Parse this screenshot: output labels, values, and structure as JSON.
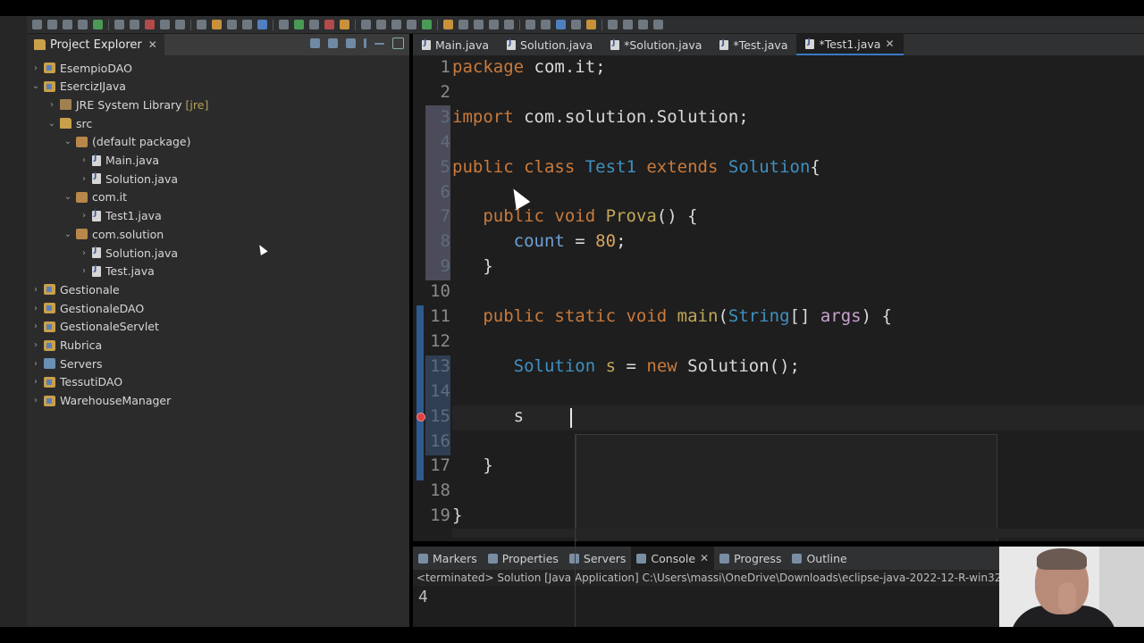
{
  "project_explorer": {
    "title": "Project Explorer",
    "tree": [
      {
        "label": "EsempioDAO",
        "level": 0,
        "expanded": false,
        "icon": "project-icon"
      },
      {
        "label": "EsercizIJava",
        "level": 0,
        "expanded": true,
        "icon": "project-icon"
      },
      {
        "label": "JRE System Library",
        "decoration": "[jre]",
        "level": 1,
        "expanded": false,
        "icon": "library-icon"
      },
      {
        "label": "src",
        "level": 1,
        "expanded": true,
        "icon": "folder-icon"
      },
      {
        "label": "(default package)",
        "level": 2,
        "expanded": true,
        "icon": "package-icon"
      },
      {
        "label": "Main.java",
        "level": 3,
        "expanded": false,
        "icon": "java-file-icon"
      },
      {
        "label": "Solution.java",
        "level": 3,
        "expanded": false,
        "icon": "java-file-icon"
      },
      {
        "label": "com.it",
        "level": 2,
        "expanded": true,
        "icon": "package-icon"
      },
      {
        "label": "Test1.java",
        "level": 3,
        "expanded": false,
        "icon": "java-file-icon"
      },
      {
        "label": "com.solution",
        "level": 2,
        "expanded": true,
        "icon": "package-icon"
      },
      {
        "label": "Solution.java",
        "level": 3,
        "expanded": false,
        "icon": "java-file-icon"
      },
      {
        "label": "Test.java",
        "level": 3,
        "expanded": false,
        "icon": "java-file-icon"
      },
      {
        "label": "Gestionale",
        "level": 0,
        "expanded": false,
        "icon": "project-icon"
      },
      {
        "label": "GestionaleDAO",
        "level": 0,
        "expanded": false,
        "icon": "project-icon"
      },
      {
        "label": "GestionaleServlet",
        "level": 0,
        "expanded": false,
        "icon": "project-icon"
      },
      {
        "label": "Rubrica",
        "level": 0,
        "expanded": false,
        "icon": "project-icon"
      },
      {
        "label": "Servers",
        "level": 0,
        "expanded": false,
        "icon": "servers-folder-icon"
      },
      {
        "label": "TessutiDAO",
        "level": 0,
        "expanded": false,
        "icon": "project-icon"
      },
      {
        "label": "WarehouseManager",
        "level": 0,
        "expanded": false,
        "icon": "project-icon"
      }
    ]
  },
  "editor": {
    "tabs": [
      {
        "label": "Main.java",
        "active": false
      },
      {
        "label": "Solution.java",
        "active": false
      },
      {
        "label": "*Solution.java",
        "active": false
      },
      {
        "label": "*Test.java",
        "active": false
      },
      {
        "label": "*Test1.java",
        "active": true
      }
    ],
    "lines": [
      {
        "n": "1",
        "tokens": [
          {
            "t": "package",
            "c": "kw"
          },
          {
            "t": " com.it;",
            "c": ""
          }
        ]
      },
      {
        "n": "2",
        "tokens": []
      },
      {
        "n": "3",
        "tokens": [
          {
            "t": "import",
            "c": "kw"
          },
          {
            "t": " com.solution.Solution;",
            "c": ""
          }
        ]
      },
      {
        "n": "4",
        "tokens": []
      },
      {
        "n": "5",
        "tokens": [
          {
            "t": "public class ",
            "c": "kw"
          },
          {
            "t": "Test1",
            "c": "ty"
          },
          {
            "t": " extends ",
            "c": "kw"
          },
          {
            "t": "Solution",
            "c": "ty"
          },
          {
            "t": "{",
            "c": ""
          }
        ]
      },
      {
        "n": "6",
        "tokens": []
      },
      {
        "n": "7",
        "tokens": [
          {
            "t": "   public void ",
            "c": "kw"
          },
          {
            "t": "Prova",
            "c": "mt"
          },
          {
            "t": "() {",
            "c": ""
          }
        ]
      },
      {
        "n": "8",
        "tokens": [
          {
            "t": "      ",
            "c": ""
          },
          {
            "t": "count",
            "c": "fd"
          },
          {
            "t": " = ",
            "c": ""
          },
          {
            "t": "80",
            "c": "num"
          },
          {
            "t": ";",
            "c": ""
          }
        ]
      },
      {
        "n": "9",
        "tokens": [
          {
            "t": "   }",
            "c": ""
          }
        ]
      },
      {
        "n": "10",
        "tokens": []
      },
      {
        "n": "11",
        "tokens": [
          {
            "t": "   public static void ",
            "c": "kw"
          },
          {
            "t": "main",
            "c": "mt"
          },
          {
            "t": "(",
            "c": ""
          },
          {
            "t": "String",
            "c": "ty"
          },
          {
            "t": "[] ",
            "c": ""
          },
          {
            "t": "args",
            "c": "vr"
          },
          {
            "t": ") {",
            "c": ""
          }
        ]
      },
      {
        "n": "12",
        "tokens": []
      },
      {
        "n": "13",
        "tokens": [
          {
            "t": "      ",
            "c": ""
          },
          {
            "t": "Solution",
            "c": "ty"
          },
          {
            "t": " s",
            "c": "mt"
          },
          {
            "t": " = ",
            "c": ""
          },
          {
            "t": "new",
            "c": "kw"
          },
          {
            "t": " Solution();",
            "c": ""
          }
        ]
      },
      {
        "n": "14",
        "tokens": []
      },
      {
        "n": "15",
        "tokens": [
          {
            "t": "      s",
            "c": ""
          }
        ]
      },
      {
        "n": "16",
        "tokens": []
      },
      {
        "n": "17",
        "tokens": [
          {
            "t": "   }",
            "c": ""
          }
        ]
      },
      {
        "n": "18",
        "tokens": []
      },
      {
        "n": "19",
        "tokens": [
          {
            "t": "}",
            "c": ""
          }
        ]
      }
    ]
  },
  "bottom_panel": {
    "tabs": [
      {
        "label": "Markers",
        "active": false
      },
      {
        "label": "Properties",
        "active": false
      },
      {
        "label": "Servers",
        "active": false
      },
      {
        "label": "Console",
        "active": true
      },
      {
        "label": "Progress",
        "active": false
      },
      {
        "label": "Outline",
        "active": false
      }
    ],
    "console_header": "<terminated> Solution [Java Application] C:\\Users\\massi\\OneDrive\\Downloads\\eclipse-java-2022-12-R-win32",
    "console_output": "4"
  }
}
